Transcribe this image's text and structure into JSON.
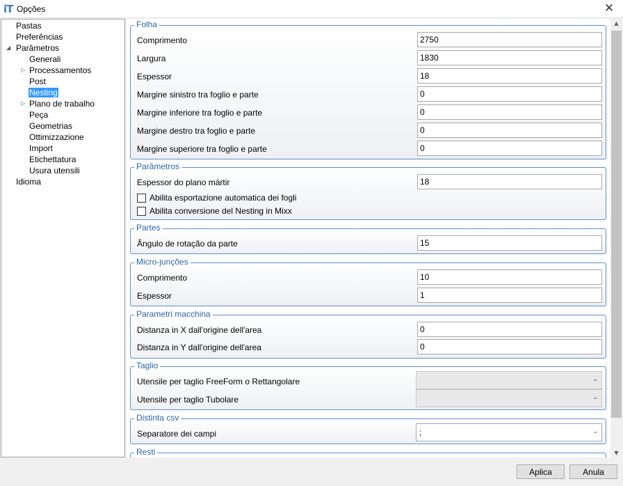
{
  "window": {
    "title": "Opções",
    "logo": "iT"
  },
  "tree": [
    {
      "label": "Pastas",
      "indent": 0,
      "expander": ""
    },
    {
      "label": "Preferências",
      "indent": 0,
      "expander": ""
    },
    {
      "label": "Parâmetros",
      "indent": 0,
      "expander": "expanded"
    },
    {
      "label": "Generali",
      "indent": 1,
      "expander": ""
    },
    {
      "label": "Processamentos",
      "indent": 1,
      "expander": "collapsed"
    },
    {
      "label": "Post",
      "indent": 1,
      "expander": ""
    },
    {
      "label": "Nesting",
      "indent": 1,
      "expander": "",
      "selected": true
    },
    {
      "label": "Plano de trabalho",
      "indent": 1,
      "expander": "collapsed"
    },
    {
      "label": "Peça",
      "indent": 1,
      "expander": ""
    },
    {
      "label": "Geometrias",
      "indent": 1,
      "expander": ""
    },
    {
      "label": "Ottimizzazione",
      "indent": 1,
      "expander": ""
    },
    {
      "label": "Import",
      "indent": 1,
      "expander": ""
    },
    {
      "label": "Etichettatura",
      "indent": 1,
      "expander": ""
    },
    {
      "label": "Usura utensili",
      "indent": 1,
      "expander": ""
    },
    {
      "label": "Idioma",
      "indent": 0,
      "expander": ""
    }
  ],
  "groups": {
    "folha": {
      "header": "Folha",
      "fields": [
        {
          "label": "Comprimento",
          "value": "2750"
        },
        {
          "label": "Largura",
          "value": "1830"
        },
        {
          "label": "Espessor",
          "value": "18"
        },
        {
          "label": "Margine sinistro tra foglio e parte",
          "value": "0"
        },
        {
          "label": "Margine inferiore tra foglio e parte",
          "value": "0"
        },
        {
          "label": "Margine destro tra foglio e parte",
          "value": "0"
        },
        {
          "label": "Margine superiore tra foglio e parte",
          "value": "0"
        }
      ]
    },
    "parametros": {
      "header": "Parâmetros",
      "field": {
        "label": "Espessor do plano mártir",
        "value": "18"
      },
      "checkboxes": [
        {
          "label": "Abilita esportazione automatica dei fogli",
          "checked": false
        },
        {
          "label": "Abilita conversione del Nesting in Mixx",
          "checked": false
        }
      ]
    },
    "partes": {
      "header": "Partes",
      "field": {
        "label": "Ângulo de rotação da parte",
        "value": "15"
      }
    },
    "micro": {
      "header": "Micro-junções",
      "fields": [
        {
          "label": "Comprimento",
          "value": "10"
        },
        {
          "label": "Espessor",
          "value": "1"
        }
      ]
    },
    "macchina": {
      "header": "Parametri macchina",
      "fields": [
        {
          "label": "Distanza in X dall'origine dell'area",
          "value": "0"
        },
        {
          "label": "Distanza in Y dall'origine dell'area",
          "value": "0"
        }
      ]
    },
    "taglio": {
      "header": "Taglio",
      "selects": [
        {
          "label": "Utensile per taglio FreeForm o Rettangolare",
          "value": ""
        },
        {
          "label": "Utensile per taglio Tubolare",
          "value": ""
        }
      ]
    },
    "csv": {
      "header": "Distinta csv",
      "select": {
        "label": "Separatore dei campi",
        "value": ";"
      }
    },
    "resti": {
      "header": "Resti"
    }
  },
  "buttons": {
    "apply": "Aplica",
    "cancel": "Anula"
  }
}
